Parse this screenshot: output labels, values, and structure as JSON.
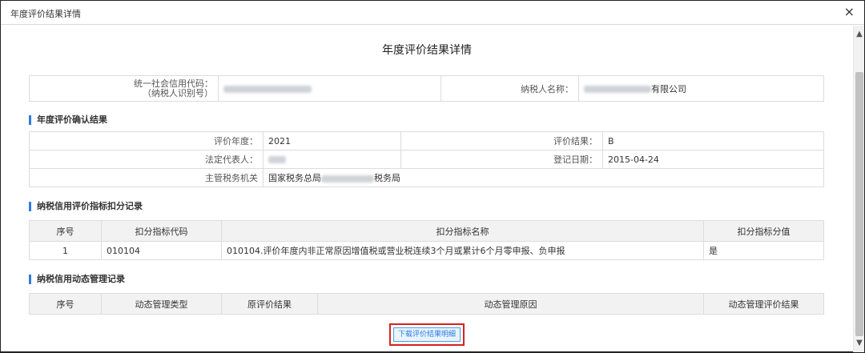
{
  "window": {
    "title": "年度评价结果详情",
    "close_icon": "×"
  },
  "page": {
    "title": "年度评价结果详情"
  },
  "header_info": {
    "credit_code_label_line1": "统一社会信用代码：",
    "credit_code_label_line2": "（纳税人识别号）",
    "taxpayer_name_label": "纳税人名称：",
    "taxpayer_name_suffix": "有限公司"
  },
  "confirm_section": {
    "heading": "年度评价确认结果",
    "eval_year_label": "评价年度：",
    "eval_year": "2021",
    "eval_result_label": "评价结果：",
    "eval_result": "B",
    "legal_rep_label": "法定代表人：",
    "reg_date_label": "登记日期：",
    "reg_date": "2015-04-24",
    "tax_authority_label": "主管税务机关",
    "tax_authority_prefix": "国家税务总局",
    "tax_authority_suffix": "税务局"
  },
  "deduction_section": {
    "heading": "纳税信用评价指标扣分记录",
    "columns": [
      "序号",
      "扣分指标代码",
      "扣分指标名称",
      "扣分指标分值"
    ],
    "rows": [
      {
        "no": "1",
        "code": "010104",
        "name": "010104.评价年度内非正常原因增值税或营业税连续3个月或累计6个月零申报、负申报",
        "score": "是"
      }
    ]
  },
  "dynamic_section": {
    "heading": "纳税信用动态管理记录",
    "columns": [
      "序号",
      "动态管理类型",
      "原评价结果",
      "动态管理原因",
      "动态管理评价结果"
    ]
  },
  "download_button": "下载评价结果明细"
}
